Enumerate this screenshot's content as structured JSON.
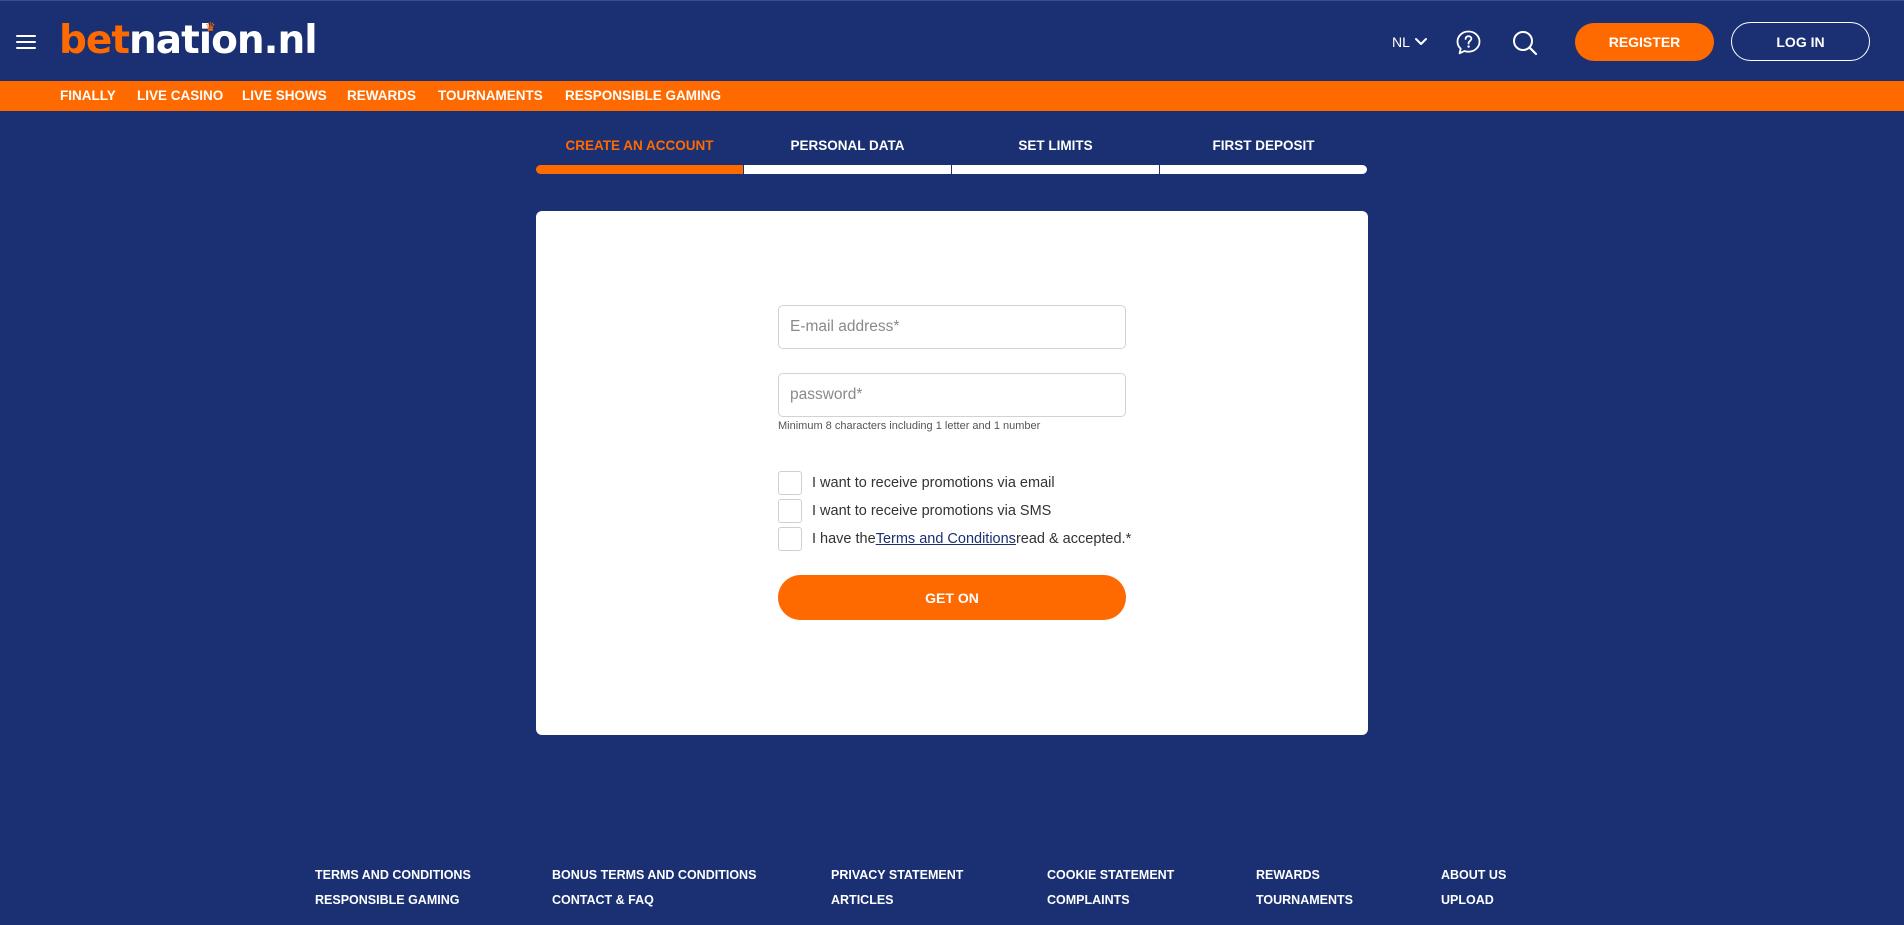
{
  "logo": {
    "part1": "bet",
    "part2": "nation.nl"
  },
  "header": {
    "language": "NL",
    "register_label": "REGISTER",
    "login_label": "LOG IN"
  },
  "nav": [
    "FINALLY",
    "LIVE CASINO",
    "LIVE SHOWS",
    "REWARDS",
    "TOURNAMENTS",
    "RESPONSIBLE GAMING"
  ],
  "steps": [
    {
      "label": "CREATE AN ACCOUNT",
      "active": true
    },
    {
      "label": "PERSONAL DATA",
      "active": false
    },
    {
      "label": "SET LIMITS",
      "active": false
    },
    {
      "label": "FIRST DEPOSIT",
      "active": false
    }
  ],
  "form": {
    "email_placeholder": "E-mail address*",
    "email_value": "",
    "password_placeholder": "password*",
    "password_value": "",
    "password_hint": "Minimum 8 characters including 1 letter and 1 number",
    "promo_email": "I want to receive promotions via email",
    "promo_sms": "I want to receive promotions via SMS",
    "terms_prefix": "I have the",
    "terms_link": "Terms and Conditions",
    "terms_suffix": "read & accepted.*",
    "submit_label": "GET ON"
  },
  "footer": {
    "col1": [
      "TERMS AND CONDITIONS",
      "RESPONSIBLE GAMING"
    ],
    "col2": [
      "BONUS TERMS AND CONDITIONS",
      "CONTACT & FAQ"
    ],
    "col3": [
      "PRIVACY STATEMENT",
      "ARTICLES"
    ],
    "col4": [
      "COOKIE STATEMENT",
      "COMPLAINTS"
    ],
    "col5": [
      "REWARDS",
      "TOURNAMENTS"
    ],
    "col6": [
      "ABOUT US",
      "UPLOAD"
    ]
  },
  "colors": {
    "brand_navy": "#1b3072",
    "brand_orange": "#ff6a00"
  }
}
